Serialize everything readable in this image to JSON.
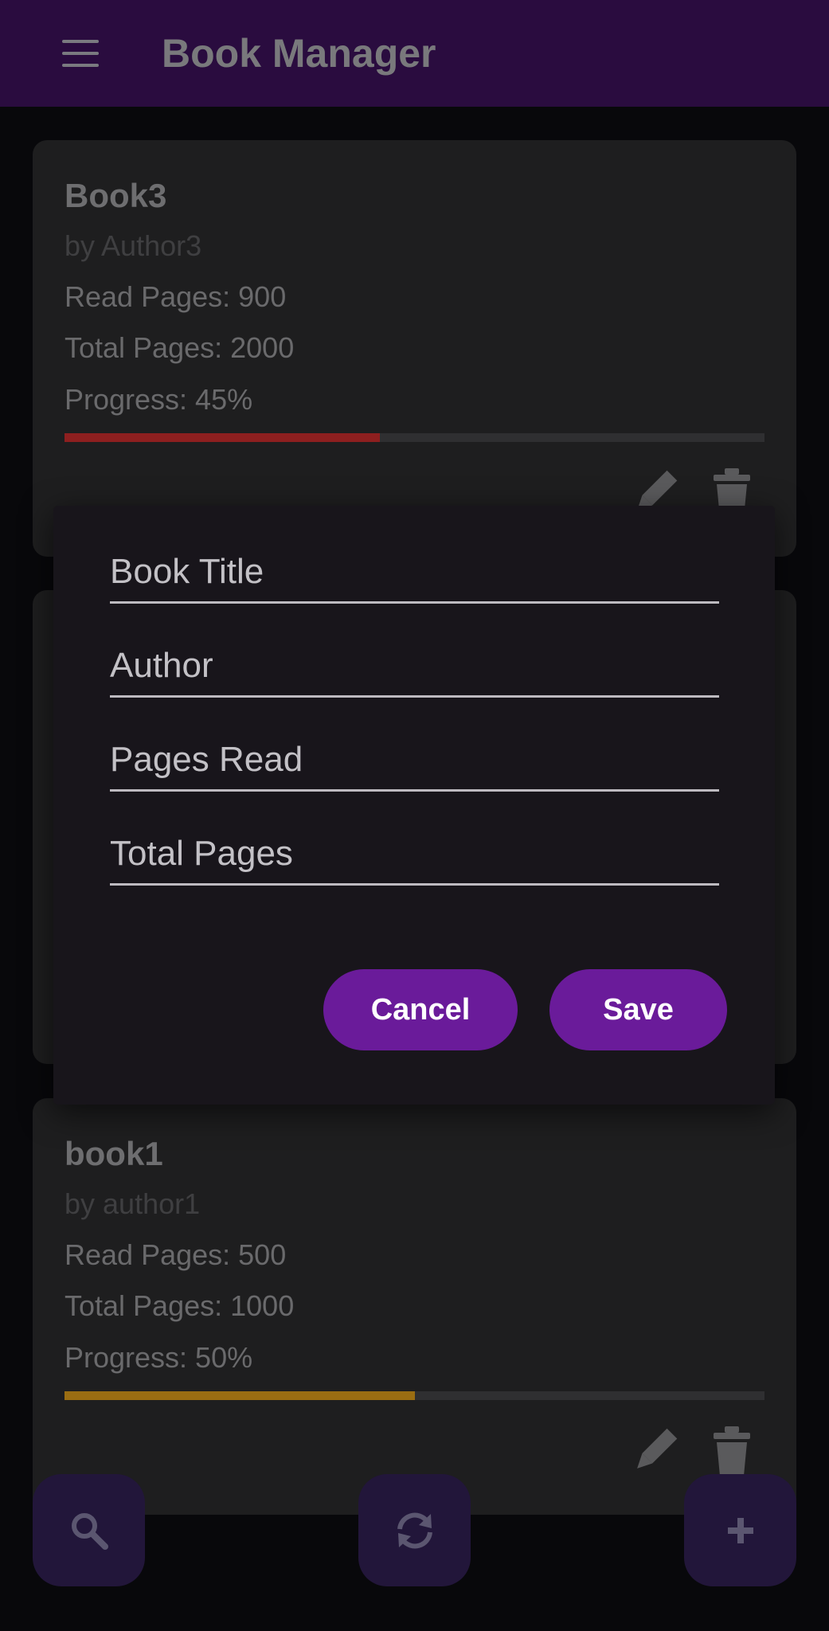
{
  "app": {
    "title": "Book Manager",
    "menu_icon": "menu-icon"
  },
  "books": [
    {
      "title": "Book3",
      "author": "by Author3",
      "read_pages": "Read Pages: 900",
      "total_pages": "Total Pages: 2000",
      "progress_text": "Progress: 45%",
      "progress": 0.45,
      "progress_color": "#8e1f1f"
    },
    {
      "title": "book1",
      "author": "by author1",
      "read_pages": "Read Pages: 500",
      "total_pages": "Total Pages: 1000",
      "progress_text": "Progress: 50%",
      "progress": 0.5,
      "progress_color": "#9a6d12"
    }
  ],
  "dialog": {
    "fields": {
      "title_placeholder": "Book Title",
      "author_placeholder": "Author",
      "pages_read_placeholder": "Pages Read",
      "total_pages_placeholder": "Total Pages"
    },
    "cancel_label": "Cancel",
    "save_label": "Save"
  },
  "fabs": {
    "search": "search-icon",
    "refresh": "refresh-icon",
    "add": "add-icon"
  },
  "colors": {
    "app_bar": "#2a0c3f",
    "accent": "#6a1b9a",
    "fab": "#22163a",
    "background": "#08080b"
  }
}
